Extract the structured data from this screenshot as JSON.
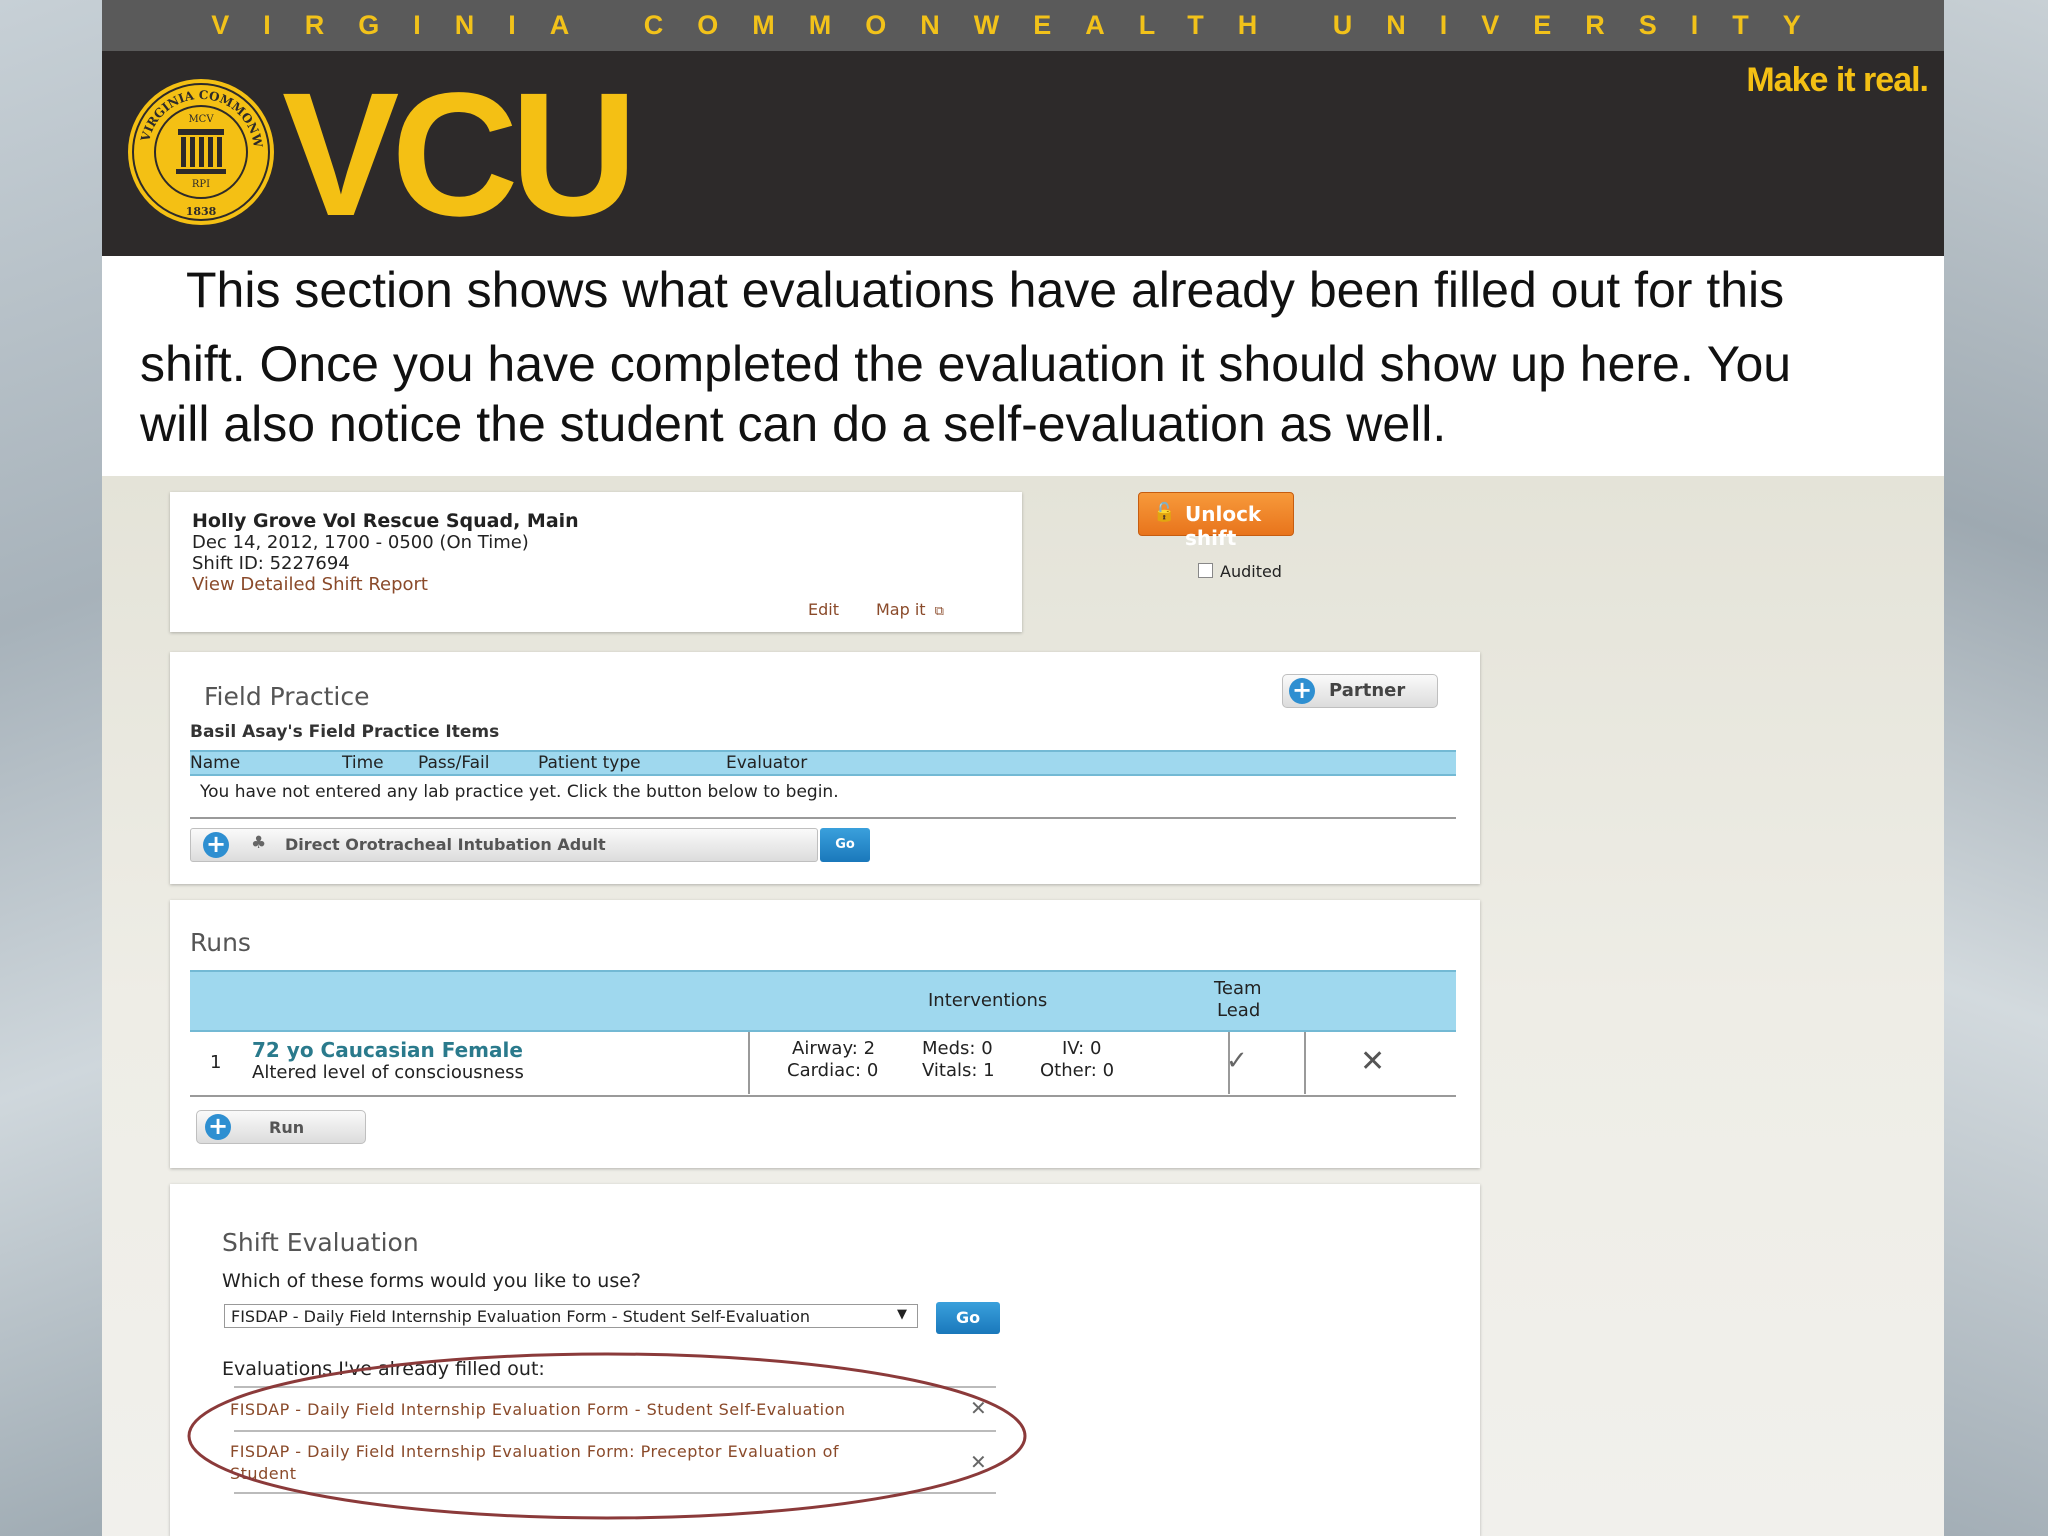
{
  "header": {
    "university_banner": "VIRGINIA COMMONWEALTH UNIVERSITY",
    "logo_text": "VCU",
    "tagline": "Make it real.",
    "seal": {
      "top_text": "COMMONWEALTH",
      "left_text": "VIRGINIA",
      "right_text": "UNIVERSITY",
      "mcv": "MCV",
      "rpi": "RPI",
      "year": "1838"
    }
  },
  "caption": {
    "line1": "This section shows what evaluations have already been filled out for this",
    "line2": "shift. Once you have completed the evaluation it should show up here. You",
    "line3": "will also notice the student can do a self-evaluation as well."
  },
  "shift": {
    "site": "Holly Grove Vol Rescue Squad, Main",
    "datetime": "Dec 14, 2012, 1700 - 0500 (On Time)",
    "shift_id": "Shift ID: 5227694",
    "report_link": "View Detailed Shift Report",
    "edit": "Edit",
    "map": "Map it",
    "unlock_button": "Unlock shift",
    "audited_label": "Audited"
  },
  "field_practice": {
    "title": "Field Practice",
    "partner_button": "Partner",
    "subtitle": "Basil Asay's Field Practice Items",
    "columns": [
      "Name",
      "Time",
      "Pass/Fail",
      "Patient type",
      "Evaluator"
    ],
    "empty_message": "You have not entered any lab practice yet. Click the button below to begin.",
    "item_select": "Direct Orotracheal Intubation Adult",
    "go": "Go"
  },
  "runs": {
    "title": "Runs",
    "col_interventions": "Interventions",
    "col_team_lead_1": "Team",
    "col_team_lead_2": "Lead",
    "rows": [
      {
        "number": "1",
        "patient": "72 yo Caucasian Female",
        "complaint": "Altered level of consciousness",
        "airway": "Airway: 2",
        "cardiac": "Cardiac: 0",
        "meds": "Meds: 0",
        "vitals": "Vitals: 1",
        "iv": "IV: 0",
        "other": "Other: 0"
      }
    ],
    "add_button": "Run"
  },
  "shift_evaluation": {
    "title": "Shift Evaluation",
    "prompt": "Which of these forms would you like to use?",
    "selected_form": "FISDAP - Daily Field Internship Evaluation Form - Student Self-Evaluation",
    "go": "Go",
    "filled_heading": "Evaluations I've already filled out:",
    "filled": [
      {
        "line1": "FISDAP - Daily Field Internship Evaluation Form - Student Self-Evaluation",
        "line2": ""
      },
      {
        "line1": "FISDAP - Daily Field Internship Evaluation Form: Preceptor Evaluation of",
        "line2": "Student"
      }
    ]
  },
  "colors": {
    "vcu_gold": "#f4c014",
    "header_dark": "#2d2a2a",
    "table_header": "#9fd8ee",
    "unlock_orange": "#ee8428",
    "highlight_ellipse": "#8b3a3a"
  }
}
